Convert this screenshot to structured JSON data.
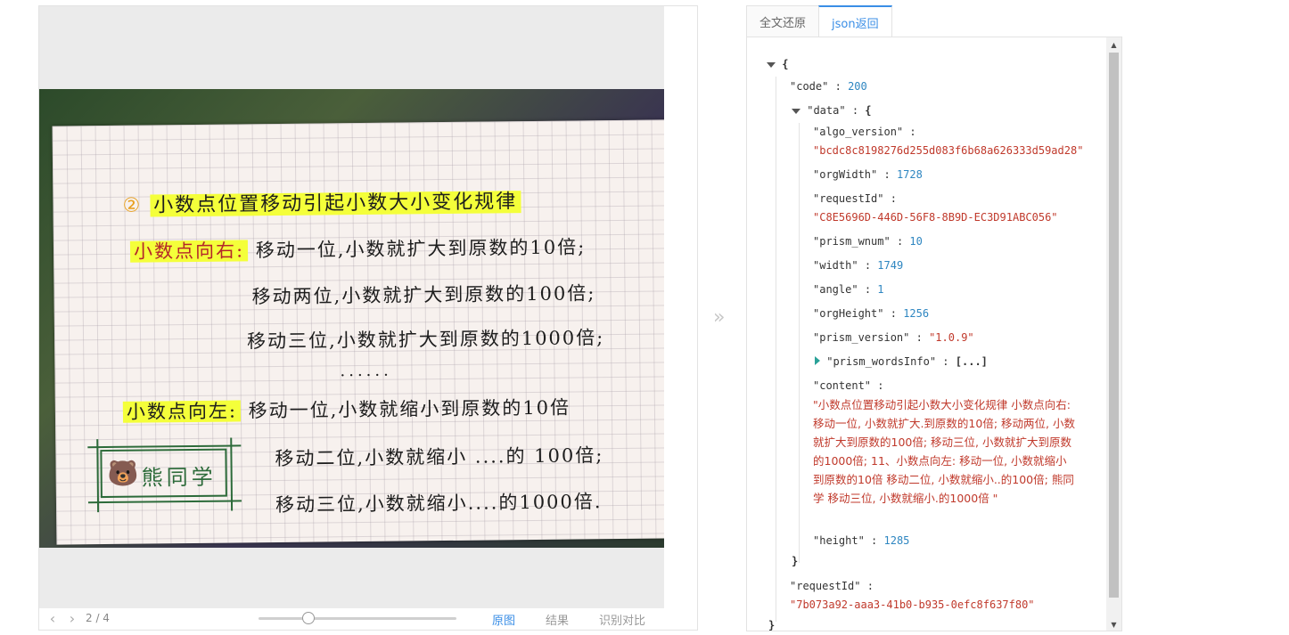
{
  "viewer": {
    "page_indicator": "2 / 4",
    "prev_icon": "chevron-left-icon",
    "next_icon": "chevron-right-icon",
    "zoom_fraction": 0.25,
    "view_tabs": [
      "原图",
      "结果",
      "识别对比"
    ],
    "active_view_tab": "原图"
  },
  "image": {
    "title": "小数点位置移动引起小数大小变化规律",
    "line1_label": "小数点向右:",
    "line1": "移动一位,小数就扩大到原数的10倍;",
    "line2": "移动两位,小数就扩大到原数的100倍;",
    "line3": "移动三位,小数就扩大到原数的1000倍;",
    "dots": "......",
    "line4_label": "小数点向左:",
    "line4": "移动一位,小数就缩小到原数的10倍",
    "line5": "移动二位,小数就缩小 ....的 100倍;",
    "line6": "移动三位,小数就缩小....的1000倍.",
    "stamp": "熊同学"
  },
  "tabs": [
    "全文还原",
    "json返回"
  ],
  "active_tab": "json返回",
  "json": {
    "open_brace": "{",
    "close_brace": "}",
    "code_key": "\"code\"",
    "code_val": "200",
    "data_key": "\"data\"",
    "data_open": "{",
    "algo_key": "\"algo_version\"",
    "algo_val": "\"bcdc8c8198276d255d083f6b68a626333d59ad28\"",
    "orgWidth_key": "\"orgWidth\"",
    "orgWidth_val": "1728",
    "requestId_inner_key": "\"requestId\"",
    "requestId_inner_val": "\"C8E5696D-446D-56F8-8B9D-EC3D91ABC056\"",
    "prism_wnum_key": "\"prism_wnum\"",
    "prism_wnum_val": "10",
    "width_key": "\"width\"",
    "width_val": "1749",
    "angle_key": "\"angle\"",
    "angle_val": "1",
    "orgHeight_key": "\"orgHeight\"",
    "orgHeight_val": "1256",
    "prism_version_key": "\"prism_version\"",
    "prism_version_val": "\"1.0.9\"",
    "wordsInfo_key": "\"prism_wordsInfo\"",
    "wordsInfo_val": "[...]",
    "content_key": "\"content\"",
    "content_val": "\"小数点位置移动引起小数大小变化规律 小数点向右: 移动一位, 小数就扩大.到原数的10倍; 移动两位, 小数就扩大到原数的100倍; 移动三位, 小数就扩大到原数的1000倍; 11、小数点向左: 移动一位, 小数就缩小到原数的10倍 移动二位, 小数就缩小..的100倍; 熊同学 移动三位, 小数就缩小.的1000倍 \"",
    "height_key": "\"height\"",
    "height_val": "1285",
    "data_close": "}",
    "requestId_key": "\"requestId\"",
    "requestId_val": "\"7b073a92-aaa3-41b0-b935-0efc8f637f80\"",
    "colon": ":"
  }
}
